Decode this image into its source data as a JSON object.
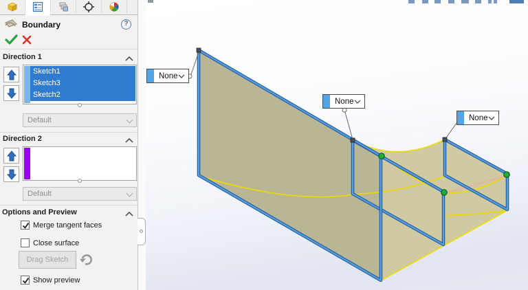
{
  "panel": {
    "tabs": [
      {
        "icon": "part-feature-tree-icon"
      },
      {
        "icon": "property-manager-icon",
        "selected": true
      },
      {
        "icon": "configuration-manager-icon"
      },
      {
        "icon": "dimxpert-icon"
      },
      {
        "icon": "display-manager-icon"
      }
    ],
    "title": "Boundary",
    "help_glyph": "?",
    "direction1": {
      "label": "Direction 1",
      "items": [
        "Sketch1",
        "Sketch3",
        "Sketch2"
      ],
      "dropdown_value": "Default",
      "accent_color": "#7ab7e8"
    },
    "direction2": {
      "label": "Direction 2",
      "items": [],
      "dropdown_value": "Default",
      "accent_color": "#9c00f0"
    },
    "options": {
      "label": "Options and Preview",
      "checkboxes": [
        {
          "label": "Merge tangent faces",
          "checked": true
        },
        {
          "label": "Close surface",
          "checked": false
        },
        {
          "label": "Show preview",
          "checked": true
        }
      ],
      "drag_sketch_label": "Drag Sketch"
    }
  },
  "viewport": {
    "callouts": [
      {
        "label": "None"
      },
      {
        "label": "None"
      },
      {
        "label": "None"
      }
    ],
    "colors": {
      "sketch_blue": "#3f83c9",
      "surface_khaki": "#cfcaa2",
      "surface_khaki_dark": "#b9b696",
      "edge_yellow": "#ecd909",
      "vertex_green": "#1fae3e",
      "connector_pink": "#efaaa8",
      "callout_swatch": "#53a5e8"
    }
  }
}
